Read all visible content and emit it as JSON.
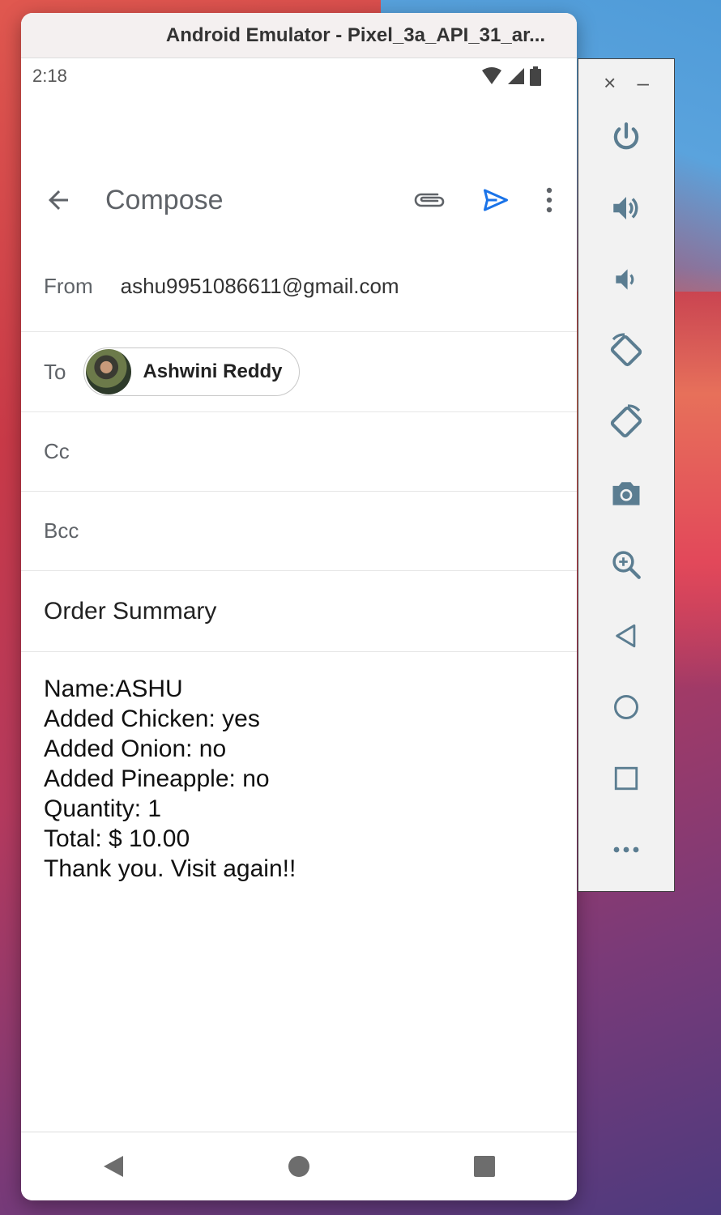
{
  "window": {
    "title": "Android Emulator - Pixel_3a_API_31_ar..."
  },
  "status_bar": {
    "time": "2:18"
  },
  "app_bar": {
    "title": "Compose"
  },
  "compose": {
    "from_label": "From",
    "from_value": "ashu9951086611@gmail.com",
    "to_label": "To",
    "to_chip_name": "Ashwini Reddy",
    "cc_label": "Cc",
    "bcc_label": "Bcc",
    "subject": "Order Summary",
    "body_lines": [
      "Name:ASHU",
      "Added Chicken: yes",
      "Added Onion: no",
      "Added Pineapple: no",
      "Quantity: 1",
      "Total: $ 10.00",
      "Thank you. Visit again!!"
    ]
  },
  "toolbar": {
    "close_symbol": "×",
    "minimize_symbol": "–",
    "icons": [
      "power-icon",
      "volume-up-icon",
      "volume-down-icon",
      "rotate-left-icon",
      "rotate-right-icon",
      "camera-icon",
      "zoom-icon",
      "back-icon",
      "home-icon",
      "overview-icon",
      "more-icon"
    ]
  },
  "colors": {
    "send": "#1a73e8",
    "toolbar_icon": "#5b7d91"
  }
}
